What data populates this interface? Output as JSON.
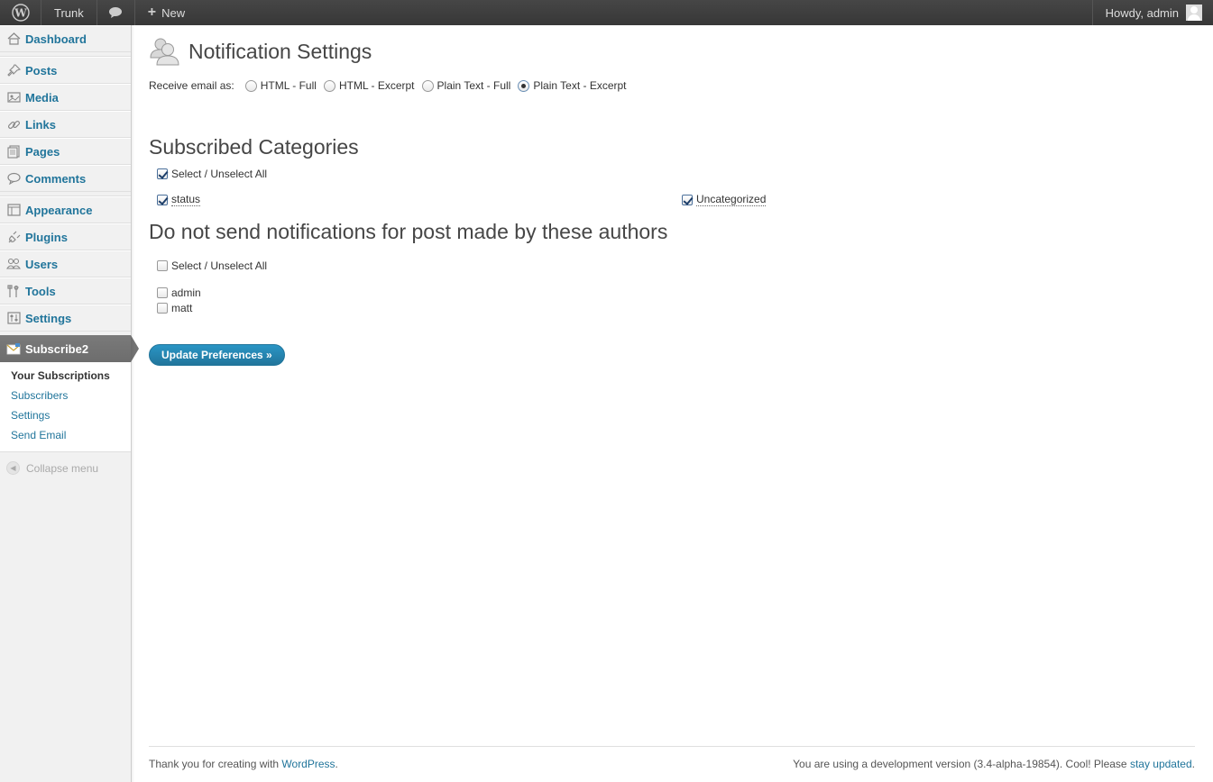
{
  "adminbar": {
    "site_name": "Trunk",
    "new_label": "New",
    "howdy": "Howdy, admin"
  },
  "sidebar": {
    "items": [
      {
        "label": "Dashboard",
        "icon": "house-icon"
      },
      {
        "label": "Posts",
        "icon": "pushpin-icon"
      },
      {
        "label": "Media",
        "icon": "media-icon"
      },
      {
        "label": "Links",
        "icon": "chain-link-icon"
      },
      {
        "label": "Pages",
        "icon": "page-icon"
      },
      {
        "label": "Comments",
        "icon": "speech-bubble-icon"
      },
      {
        "label": "Appearance",
        "icon": "appearance-icon"
      },
      {
        "label": "Plugins",
        "icon": "plug-icon"
      },
      {
        "label": "Users",
        "icon": "users-icon"
      },
      {
        "label": "Tools",
        "icon": "tools-icon"
      },
      {
        "label": "Settings",
        "icon": "sliders-icon"
      }
    ],
    "active": {
      "label": "Subscribe2",
      "icon": "envelope-icon"
    },
    "submenu": [
      "Your Subscriptions",
      "Subscribers",
      "Settings",
      "Send Email"
    ],
    "collapse_label": "Collapse menu"
  },
  "main": {
    "title": "Notification Settings",
    "email_label": "Receive email as:",
    "email_options": [
      "HTML - Full",
      "HTML - Excerpt",
      "Plain Text - Full",
      "Plain Text - Excerpt"
    ],
    "email_selected": "Plain Text - Excerpt",
    "categories_heading": "Subscribed Categories",
    "select_all_label": "Select / Unselect All",
    "categories": [
      "status",
      "Uncategorized"
    ],
    "authors_heading": "Do not send notifications for post made by these authors",
    "authors": [
      "admin",
      "matt"
    ],
    "update_button": "Update Preferences »"
  },
  "footer": {
    "left_text": "Thank you for creating with ",
    "left_link": "WordPress",
    "left_end": ".",
    "right_text": "You are using a development version (3.4-alpha-19854). Cool! Please ",
    "right_link": "stay updated",
    "right_end": "."
  },
  "colors": {
    "link": "#21759b",
    "adminbar": "#464646",
    "active_menu": "#737373"
  }
}
